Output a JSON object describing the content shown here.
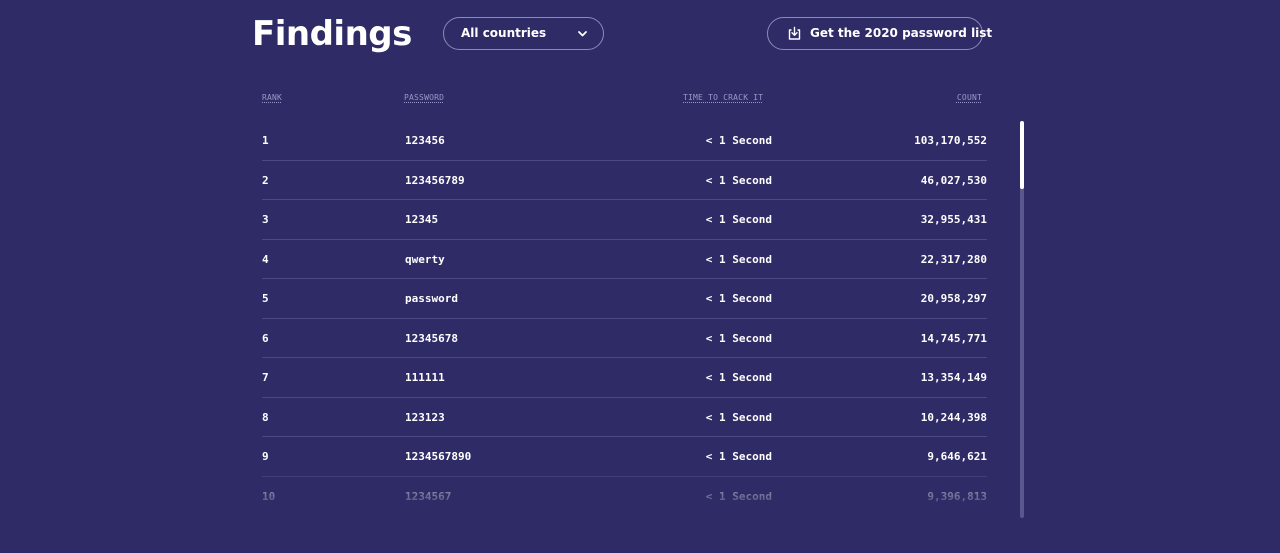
{
  "header": {
    "title": "Findings",
    "country_select": {
      "value": "All countries"
    },
    "download_button": {
      "label": "Get the 2020 password list"
    }
  },
  "table": {
    "columns": [
      "RANK",
      "PASSWORD",
      "TIME TO CRACK IT",
      "COUNT"
    ],
    "rows": [
      {
        "rank": "1",
        "password": "123456",
        "time": "< 1 Second",
        "count": "103,170,552"
      },
      {
        "rank": "2",
        "password": "123456789",
        "time": "< 1 Second",
        "count": "46,027,530"
      },
      {
        "rank": "3",
        "password": "12345",
        "time": "< 1 Second",
        "count": "32,955,431"
      },
      {
        "rank": "4",
        "password": "qwerty",
        "time": "< 1 Second",
        "count": "22,317,280"
      },
      {
        "rank": "5",
        "password": "password",
        "time": "< 1 Second",
        "count": "20,958,297"
      },
      {
        "rank": "6",
        "password": "12345678",
        "time": "< 1 Second",
        "count": "14,745,771"
      },
      {
        "rank": "7",
        "password": "111111",
        "time": "< 1 Second",
        "count": "13,354,149"
      },
      {
        "rank": "8",
        "password": "123123",
        "time": "< 1 Second",
        "count": "10,244,398"
      },
      {
        "rank": "9",
        "password": "1234567890",
        "time": "< 1 Second",
        "count": "9,646,621"
      },
      {
        "rank": "10",
        "password": "1234567",
        "time": "< 1 Second",
        "count": "9,396,813"
      }
    ]
  },
  "colors": {
    "background": "#2e2b66",
    "divider": "#4b4885",
    "header_text": "#9a97c8",
    "text": "#ffffff"
  },
  "icons": {
    "country_select": "chevron-down-icon",
    "download_button": "download-icon"
  }
}
